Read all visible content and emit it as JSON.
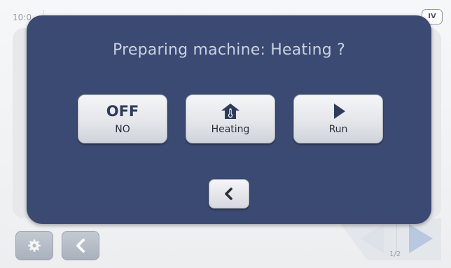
{
  "background": {
    "time": "10:0",
    "badge": "IV",
    "pagination": "1/2",
    "icons": {
      "settings": "gear-icon",
      "back": "chevron-left-icon",
      "prev": "triangle-left-icon",
      "next": "triangle-right-icon"
    }
  },
  "dialog": {
    "title": "Preparing machine:  Heating ?",
    "options": [
      {
        "primary": "OFF",
        "label": "NO"
      },
      {
        "icon": "house-thermometer-icon",
        "label": "Heating"
      },
      {
        "icon": "play-icon",
        "label": "Run"
      }
    ],
    "back_icon": "chevron-left-icon"
  },
  "colors": {
    "dialog_bg": "#3b4a72",
    "title_text": "#c9d0e0",
    "button_face": "#e4e6ea",
    "icon_dark": "#2e3b5c",
    "nav_next": "#b8c9df"
  }
}
